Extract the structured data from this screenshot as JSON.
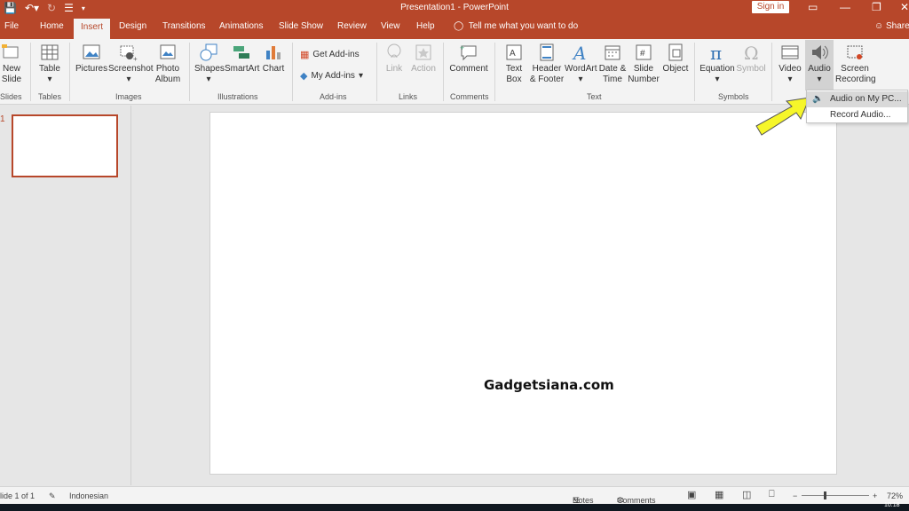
{
  "window": {
    "title": "Presentation1  -  PowerPoint",
    "sign_in": "Sign in",
    "accent": "#b7472a"
  },
  "tabs": [
    "File",
    "Home",
    "Insert",
    "Design",
    "Transitions",
    "Animations",
    "Slide Show",
    "Review",
    "View",
    "Help"
  ],
  "tell_me": "Tell me what you want to do",
  "share": "Share",
  "ribbon": {
    "new_slide": [
      "New",
      "Slide"
    ],
    "slides_group": "Slides",
    "table": "Table",
    "tables_group": "Tables",
    "pictures": "Pictures",
    "screenshot": "Screenshot",
    "photo_album": [
      "Photo",
      "Album"
    ],
    "images_group": "Images",
    "shapes": "Shapes",
    "smartart": "SmartArt",
    "chart": "Chart",
    "illustrations_group": "Illustrations",
    "get_addins": "Get Add-ins",
    "my_addins": "My Add-ins",
    "addins_group": "Add-ins",
    "link": "Link",
    "action": "Action",
    "links_group": "Links",
    "comment": "Comment",
    "comments_group": "Comments",
    "text_box": [
      "Text",
      "Box"
    ],
    "header_footer": [
      "Header",
      "& Footer"
    ],
    "wordart": "WordArt",
    "date_time": [
      "Date &",
      "Time"
    ],
    "slide_number": [
      "Slide",
      "Number"
    ],
    "object": "Object",
    "text_group": "Text",
    "equation": "Equation",
    "symbol": "Symbol",
    "symbols_group": "Symbols",
    "video": "Video",
    "audio": "Audio",
    "screen_recording": [
      "Screen",
      "Recording"
    ]
  },
  "audio_menu": {
    "items": [
      "Audio on My PC...",
      "Record Audio..."
    ]
  },
  "slides": {
    "thumb_number": "1"
  },
  "canvas": {
    "watermark": "Gadgetsiana.com"
  },
  "status": {
    "slide_count": "lide 1 of 1",
    "language": "Indonesian",
    "notes": "Notes",
    "comments": "Comments",
    "zoom": "72%",
    "zoom_minus": "−",
    "zoom_plus": "+",
    "clock": "10.18"
  }
}
